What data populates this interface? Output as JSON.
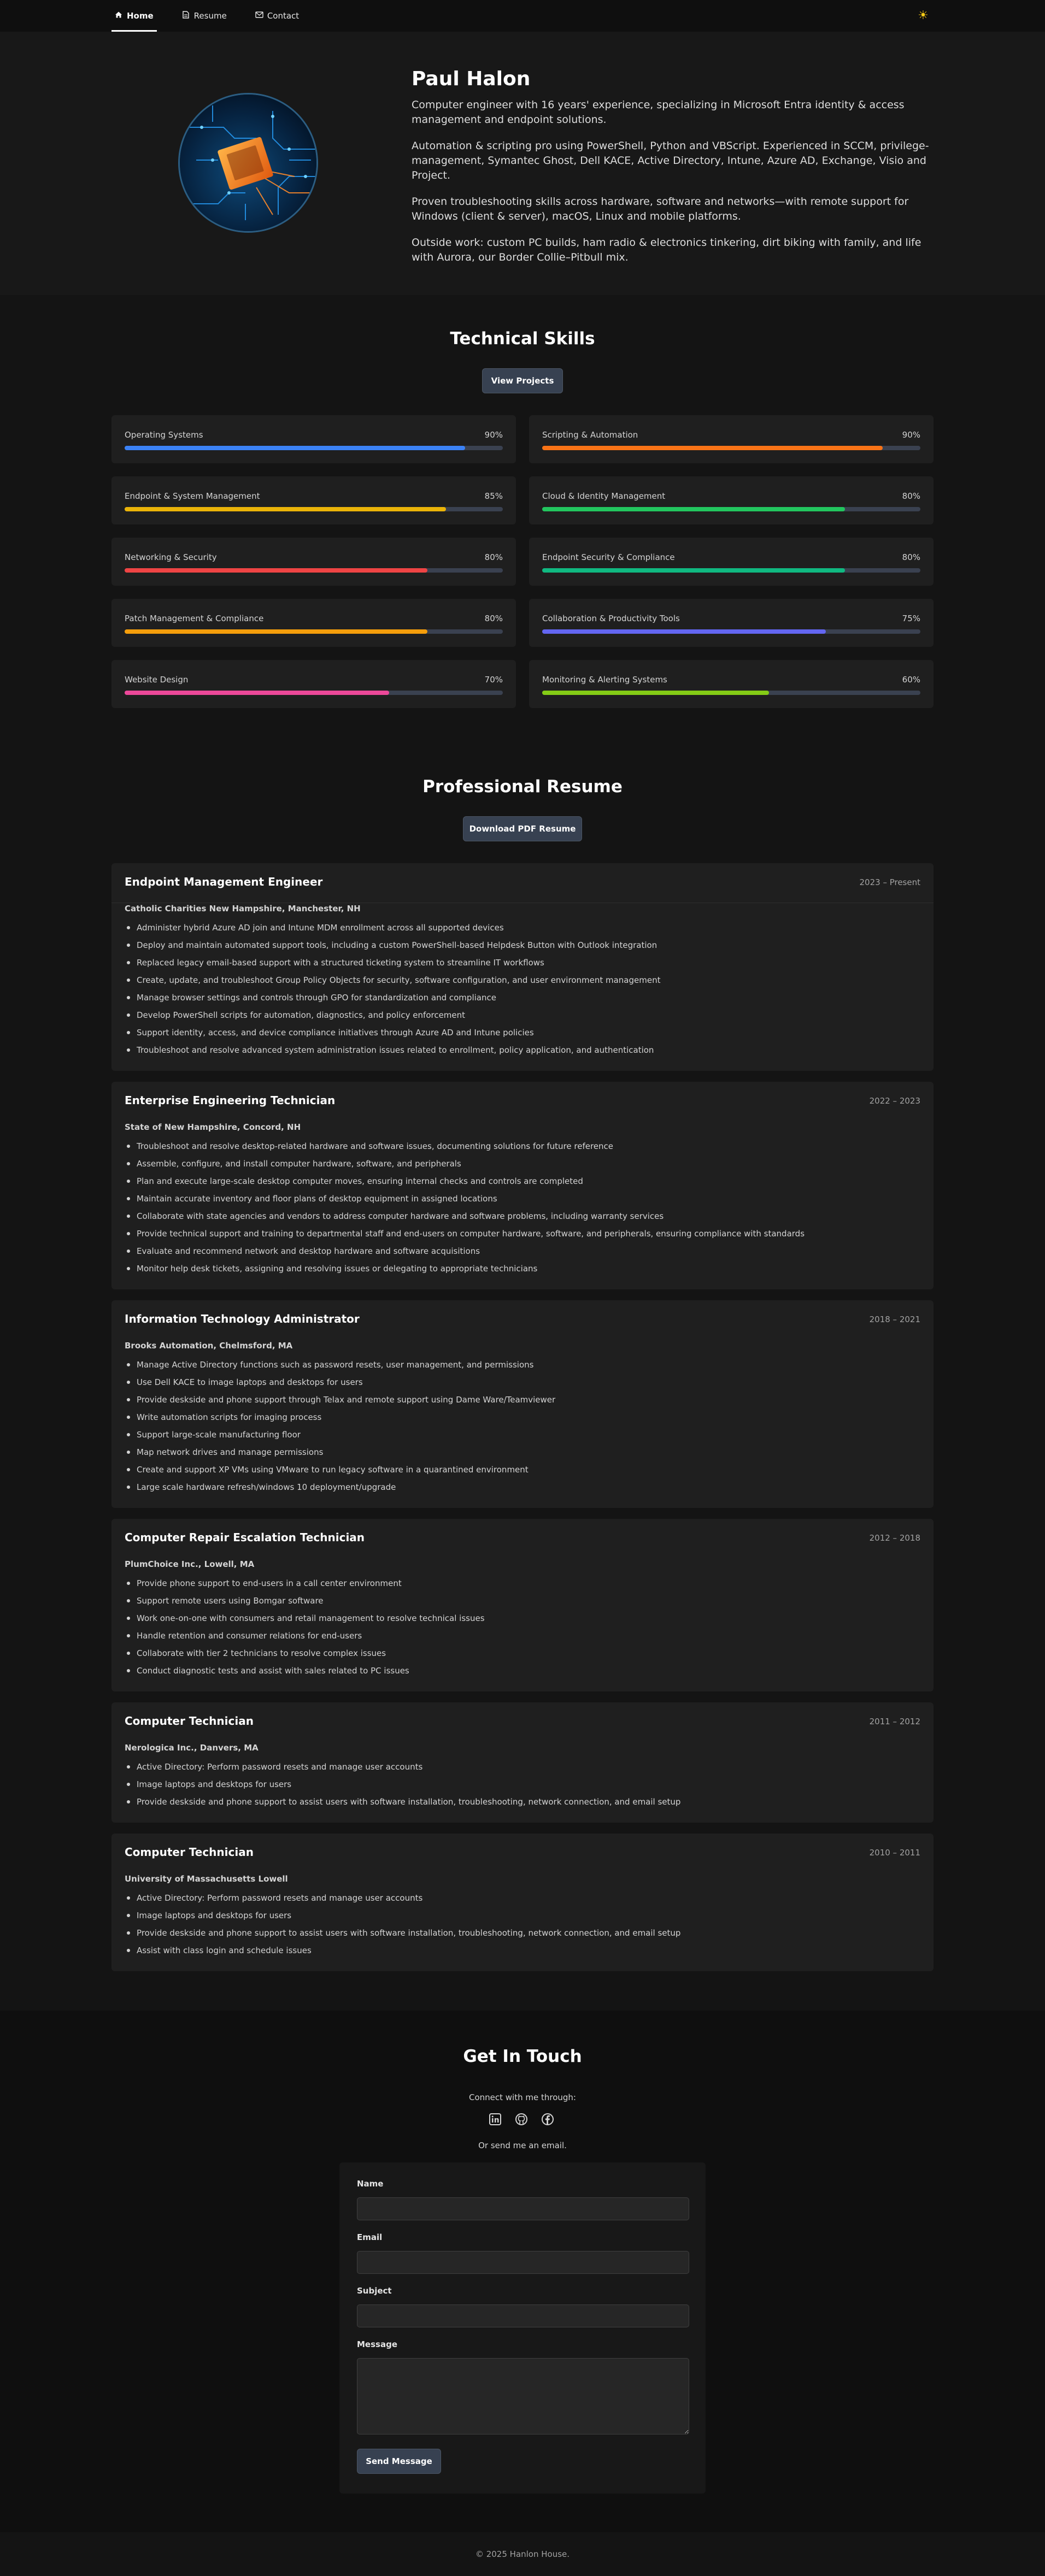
{
  "nav": {
    "items": [
      {
        "label": "Home",
        "icon": "home-icon",
        "active": true
      },
      {
        "label": "Resume",
        "icon": "document-icon",
        "active": false
      },
      {
        "label": "Contact",
        "icon": "envelope-icon",
        "active": false
      }
    ],
    "theme_icon": "sun-icon"
  },
  "hero": {
    "name": "Paul Halon",
    "paragraphs": [
      "Computer engineer with 16 years' experience, specializing in Microsoft Entra identity & access management and endpoint solutions.",
      "Automation & scripting pro using PowerShell, Python and VBScript. Experienced in SCCM, privilege-management, Symantec Ghost, Dell KACE, Active Directory, Intune, Azure AD, Exchange, Visio and Project.",
      "Proven troubleshooting skills across hardware, software and networks—with remote support for Windows (client & server), macOS, Linux and mobile platforms.",
      "Outside work: custom PC builds, ham radio & electronics tinkering, dirt biking with family, and life with Aurora, our Border Collie–Pitbull mix."
    ]
  },
  "skills": {
    "title": "Technical Skills",
    "button": "View Projects",
    "items": [
      {
        "name": "Operating Systems",
        "pct": "90%",
        "value": 0.9,
        "color": "#3b82f6"
      },
      {
        "name": "Scripting & Automation",
        "pct": "90%",
        "value": 0.9,
        "color": "#f97316"
      },
      {
        "name": "Endpoint & System Management",
        "pct": "85%",
        "value": 0.85,
        "color": "#eab308"
      },
      {
        "name": "Cloud & Identity Management",
        "pct": "80%",
        "value": 0.8,
        "color": "#22c55e"
      },
      {
        "name": "Networking & Security",
        "pct": "80%",
        "value": 0.8,
        "color": "#ef4444"
      },
      {
        "name": "Endpoint Security & Compliance",
        "pct": "80%",
        "value": 0.8,
        "color": "#10b981"
      },
      {
        "name": "Patch Management & Compliance",
        "pct": "80%",
        "value": 0.8,
        "color": "#f59e0b"
      },
      {
        "name": "Collaboration & Productivity Tools",
        "pct": "75%",
        "value": 0.75,
        "color": "#6366f1"
      },
      {
        "name": "Website Design",
        "pct": "70%",
        "value": 0.7,
        "color": "#ec4899"
      },
      {
        "name": "Monitoring & Alerting Systems",
        "pct": "60%",
        "value": 0.6,
        "color": "#84cc16"
      }
    ]
  },
  "resume": {
    "title": "Professional Resume",
    "button": "Download PDF Resume",
    "jobs": [
      {
        "title": "Endpoint Management Engineer",
        "dates": "2023 – Present",
        "company": "Catholic Charities New Hampshire, Manchester, NH",
        "bullets": [
          "Administer hybrid Azure AD join and Intune MDM enrollment across all supported devices",
          "Deploy and maintain automated support tools, including a custom PowerShell-based Helpdesk Button with Outlook integration",
          "Replaced legacy email-based support with a structured ticketing system to streamline IT workflows",
          "Create, update, and troubleshoot Group Policy Objects for security, software configuration, and user environment management",
          "Manage browser settings and controls through GPO for standardization and compliance",
          "Develop PowerShell scripts for automation, diagnostics, and policy enforcement",
          "Support identity, access, and device compliance initiatives through Azure AD and Intune policies",
          "Troubleshoot and resolve advanced system administration issues related to enrollment, policy application, and authentication"
        ]
      },
      {
        "title": "Enterprise Engineering Technician",
        "dates": "2022 – 2023",
        "company": "State of New Hampshire, Concord, NH",
        "bullets": [
          "Troubleshoot and resolve desktop-related hardware and software issues, documenting solutions for future reference",
          "Assemble, configure, and install computer hardware, software, and peripherals",
          "Plan and execute large-scale desktop computer moves, ensuring internal checks and controls are completed",
          "Maintain accurate inventory and floor plans of desktop equipment in assigned locations",
          "Collaborate with state agencies and vendors to address computer hardware and software problems, including warranty services",
          "Provide technical support and training to departmental staff and end-users on computer hardware, software, and peripherals, ensuring compliance with standards",
          "Evaluate and recommend network and desktop hardware and software acquisitions",
          "Monitor help desk tickets, assigning and resolving issues or delegating to appropriate technicians"
        ]
      },
      {
        "title": "Information Technology Administrator",
        "dates": "2018 – 2021",
        "company": "Brooks Automation, Chelmsford, MA",
        "bullets": [
          "Manage Active Directory functions such as password resets, user management, and permissions",
          "Use Dell KACE to image laptops and desktops for users",
          "Provide deskside and phone support through Telax and remote support using Dame Ware/Teamviewer",
          "Write automation scripts for imaging process",
          "Support large-scale manufacturing floor",
          "Map network drives and manage permissions",
          "Create and support XP VMs using VMware to run legacy software in a quarantined environment",
          "Large scale hardware refresh/windows 10 deployment/upgrade"
        ]
      },
      {
        "title": "Computer Repair Escalation Technician",
        "dates": "2012 – 2018",
        "company": "PlumChoice Inc., Lowell, MA",
        "bullets": [
          "Provide phone support to end-users in a call center environment",
          "Support remote users using Bomgar software",
          "Work one-on-one with consumers and retail management to resolve technical issues",
          "Handle retention and consumer relations for end-users",
          "Collaborate with tier 2 technicians to resolve complex issues",
          "Conduct diagnostic tests and assist with sales related to PC issues"
        ]
      },
      {
        "title": "Computer Technician",
        "dates": "2011 – 2012",
        "company": "Nerologica Inc., Danvers, MA",
        "bullets": [
          "Active Directory: Perform password resets and manage user accounts",
          "Image laptops and desktops for users",
          "Provide deskside and phone support to assist users with software installation, troubleshooting, network connection, and email setup"
        ]
      },
      {
        "title": "Computer Technician",
        "dates": "2010 – 2011",
        "company": "University of Massachusetts Lowell",
        "bullets": [
          "Active Directory: Perform password resets and manage user accounts",
          "Image laptops and desktops for users",
          "Provide deskside and phone support to assist users with software installation, troubleshooting, network connection, and email setup",
          "Assist with class login and schedule issues"
        ]
      }
    ]
  },
  "contact": {
    "title": "Get In Touch",
    "connect_text": "Connect with me through:",
    "socials": [
      "linkedin-icon",
      "github-icon",
      "facebook-icon"
    ],
    "email_text": "Or send me an email.",
    "form": {
      "name_label": "Name",
      "email_label": "Email",
      "subject_label": "Subject",
      "message_label": "Message",
      "name_value": "",
      "email_value": "",
      "subject_value": "",
      "message_value": "",
      "submit_label": "Send Message"
    }
  },
  "footer": {
    "text": "© 2025 Hanlon House."
  }
}
